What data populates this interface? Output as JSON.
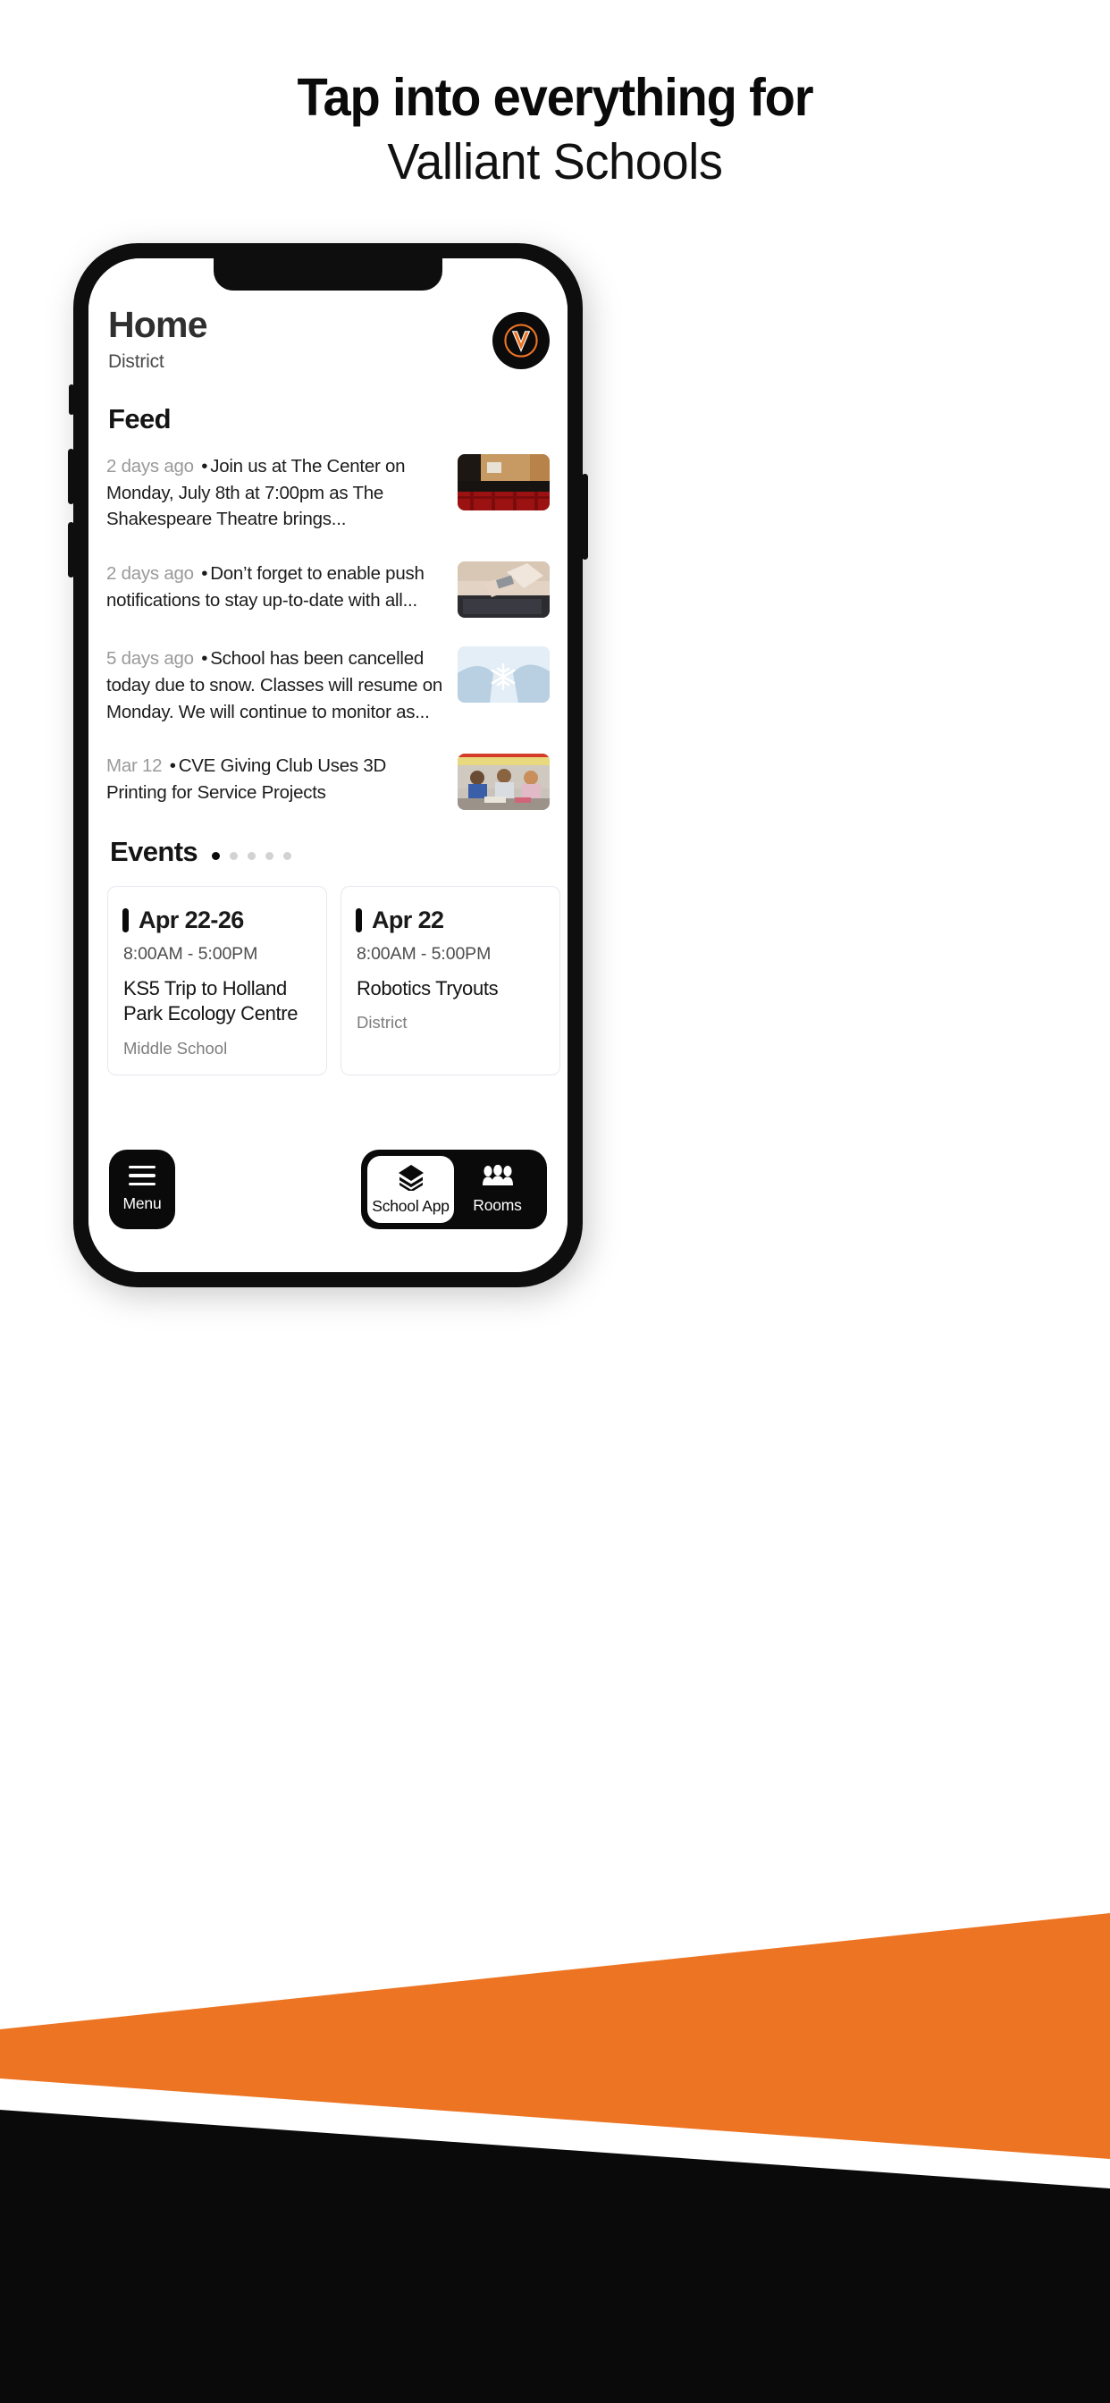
{
  "hero": {
    "headline_line1": "Tap into everything for",
    "headline_line2": "Valliant Schools"
  },
  "colors": {
    "brand_orange": "#ED7423",
    "brand_black": "#0A0A0A",
    "card_border": "#E7E7EF",
    "muted_text": "#9A9A9A"
  },
  "app": {
    "header": {
      "title": "Home",
      "subtitle": "District",
      "logo_letter": "V"
    },
    "feed": {
      "section_title": "Feed",
      "items": [
        {
          "date": "2 days ago",
          "separator": "•",
          "text": "Join us at The Center on Monday, July 8th at 7:00pm as The Shakespeare Theatre brings...",
          "thumbnail": "theatre-seats-image"
        },
        {
          "date": "2 days ago",
          "separator": "•",
          "text": "Don’t forget to enable push notifications to stay up-to-date with all...",
          "thumbnail": "phone-in-hands-image"
        },
        {
          "date": "5 days ago",
          "separator": "•",
          "text": "School has been cancelled today due to snow. Classes will resume on Monday. We will continue to monitor as...",
          "thumbnail": "snowflake-mittens-image"
        },
        {
          "date": "Mar 12",
          "separator": "•",
          "text": "CVE Giving Club Uses 3D Printing for Service Projects",
          "thumbnail": "classroom-students-image"
        }
      ]
    },
    "events": {
      "section_title": "Events",
      "pagination": {
        "total": 5,
        "active_index": 0
      },
      "cards": [
        {
          "date": "Apr 22-26",
          "time": "8:00AM  -  5:00PM",
          "name": "KS5 Trip to Holland Park Ecology Centre",
          "org": "Middle School"
        },
        {
          "date": "Apr 22",
          "time": "8:00AM  -  5:00PM",
          "name": "Robotics Tryouts",
          "org": "District"
        }
      ]
    },
    "bottom_nav": {
      "menu_label": "Menu",
      "menu_icon": "hamburger-icon",
      "segments": [
        {
          "label": "School App",
          "icon": "layers-stack-icon",
          "active": true
        },
        {
          "label": "Rooms",
          "icon": "people-group-icon",
          "active": false
        }
      ]
    }
  }
}
